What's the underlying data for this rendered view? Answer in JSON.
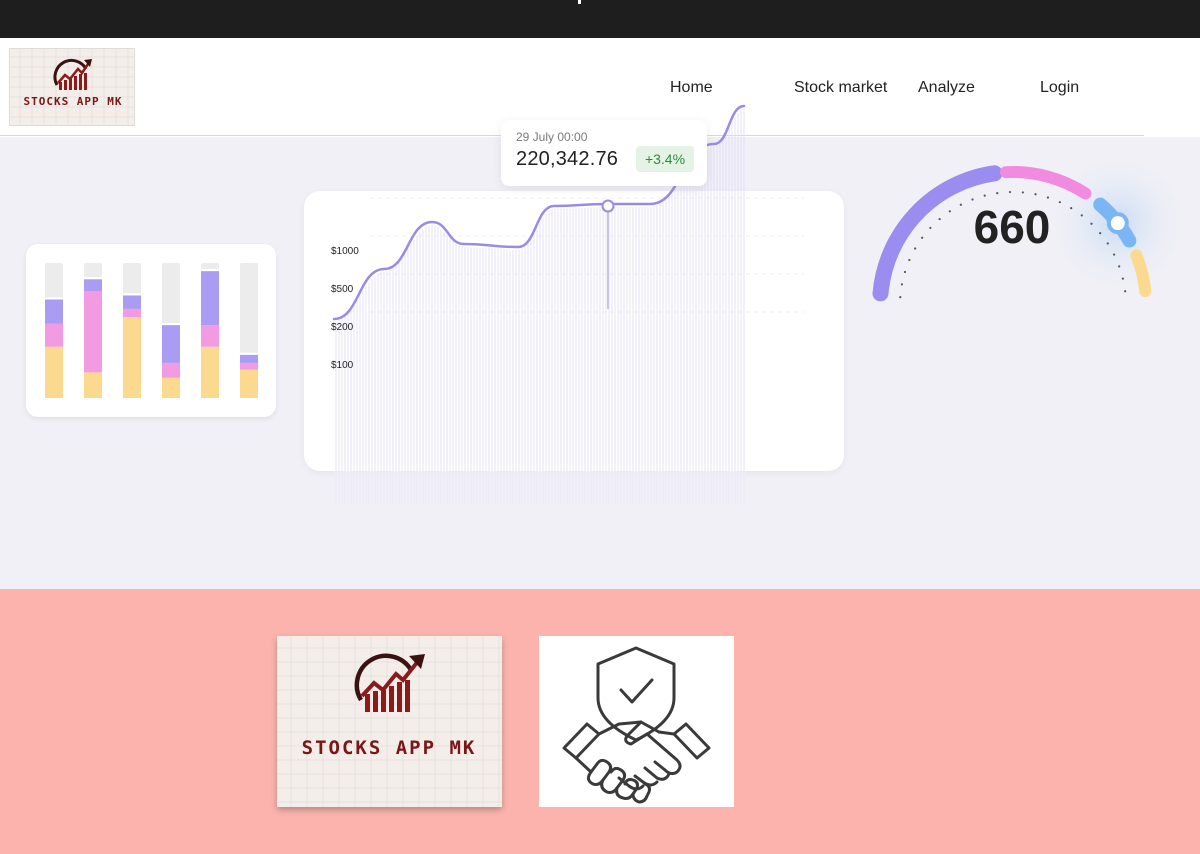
{
  "brand": {
    "logo_text": "STOCKS APP MK",
    "colors": {
      "logo_red": "#8b1a1a",
      "logo_dark": "#3a1212",
      "logo_bg": "#f3eeea"
    }
  },
  "nav": {
    "items": [
      {
        "label": "Home"
      },
      {
        "label": "Stock market"
      },
      {
        "label": "Analyze"
      },
      {
        "label": "Login"
      }
    ]
  },
  "hero": {
    "bar_widget": {
      "colors": {
        "purple": "#a99cf2",
        "pink": "#f29be3",
        "yellow": "#fbd98f",
        "empty": "#ececec"
      },
      "columns": [
        {
          "yellow": 0.38,
          "pink": 0.17,
          "purple": 0.18
        },
        {
          "yellow": 0.19,
          "pink": 0.6,
          "purple": 0.09
        },
        {
          "yellow": 0.6,
          "pink": 0.06,
          "purple": 0.1
        },
        {
          "yellow": 0.15,
          "pink": 0.11,
          "purple": 0.28
        },
        {
          "yellow": 0.38,
          "pink": 0.16,
          "purple": 0.4
        },
        {
          "yellow": 0.21,
          "pink": 0.05,
          "purple": 0.06
        }
      ]
    },
    "line_chart": {
      "y_ticks": [
        "$1000",
        "$500",
        "$200",
        "$100"
      ],
      "tooltip": {
        "date": "29 July 00:00",
        "value": "220,342.76",
        "change": "+3.4%"
      },
      "colors": {
        "line": "#9b8ae6",
        "badge_bg": "#e4f3e6",
        "badge_text": "#2f8a3b"
      }
    },
    "gauge": {
      "value": "660",
      "colors": {
        "purple": "#9b8cf0",
        "pink": "#f08be0",
        "blue": "#7ab5f5",
        "yellow": "#fbd98f"
      }
    }
  },
  "chart_data": {
    "type": "line",
    "series": [
      {
        "values": [
          60,
          100,
          130,
          100,
          90,
          90,
          175,
          175,
          172,
          175,
          300,
          1000
        ]
      }
    ],
    "y_ticks": [
      "$1000",
      "$500",
      "$200",
      "$100"
    ],
    "grid": true
  },
  "icons": {
    "trust": "handshake-shield-icon",
    "logo": "stocks-app-logo"
  }
}
